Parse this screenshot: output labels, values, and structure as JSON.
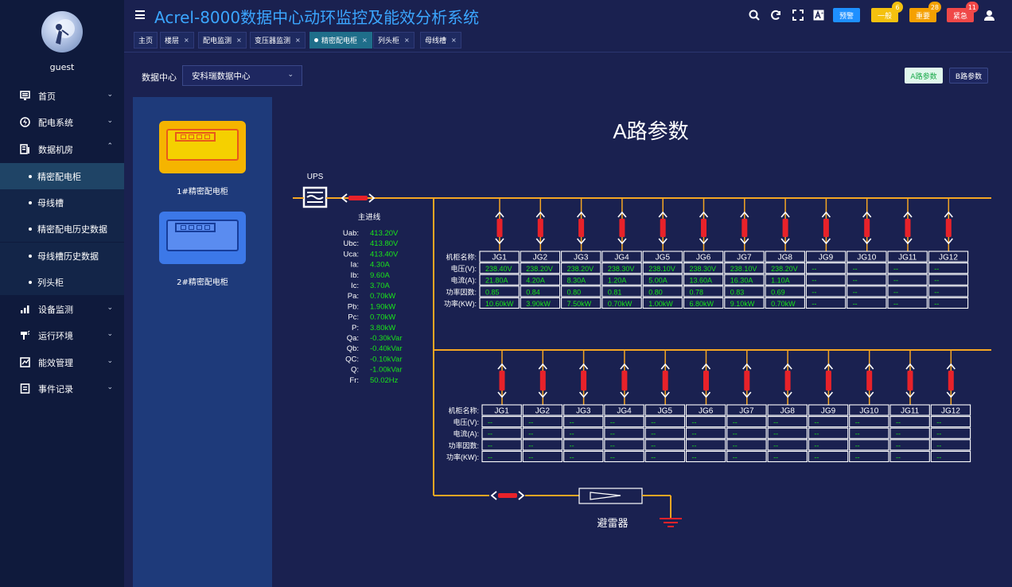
{
  "user": {
    "name": "guest"
  },
  "app": {
    "title": "Acrel-8000数据中心动环监控及能效分析系统"
  },
  "tabs": [
    {
      "label": "主页",
      "closable": false,
      "active": false
    },
    {
      "label": "楼层",
      "closable": true,
      "active": false
    },
    {
      "label": "配电监测",
      "closable": true,
      "active": false
    },
    {
      "label": "变压器监测",
      "closable": true,
      "active": false
    },
    {
      "label": "精密配电柜",
      "closable": true,
      "active": true
    },
    {
      "label": "列头柜",
      "closable": true,
      "active": false
    },
    {
      "label": "母线槽",
      "closable": true,
      "active": false
    }
  ],
  "toolbar": {
    "icons": [
      "search-icon",
      "refresh-icon",
      "fullscreen-icon",
      "font-size-icon"
    ],
    "alerts": [
      {
        "label": "预警",
        "count": "",
        "color": "#1e90ff"
      },
      {
        "label": "一般",
        "count": "6",
        "color": "#f4c10f"
      },
      {
        "label": "重要",
        "count": "28",
        "color": "#f5a000"
      },
      {
        "label": "紧急",
        "count": "11",
        "color": "#f04848"
      }
    ]
  },
  "sidebar": {
    "items": [
      {
        "label": "首页",
        "icon": "monitor-icon",
        "expanded": false
      },
      {
        "label": "配电系统",
        "icon": "power-distribution-icon",
        "expanded": false
      },
      {
        "label": "数据机房",
        "icon": "server-room-icon",
        "expanded": true,
        "children": [
          "精密配电柜",
          "母线槽",
          "精密配电历史数据",
          "母线槽历史数据",
          "列头柜"
        ]
      },
      {
        "label": "设备监测",
        "icon": "chart-icon",
        "expanded": false
      },
      {
        "label": "运行环境",
        "icon": "environment-icon",
        "expanded": false
      },
      {
        "label": "能效管理",
        "icon": "energy-icon",
        "expanded": false
      },
      {
        "label": "事件记录",
        "icon": "event-log-icon",
        "expanded": false
      }
    ],
    "active_child": "精密配电柜"
  },
  "filter": {
    "label": "数据中心",
    "value": "安科瑞数据中心"
  },
  "param_buttons": {
    "a": "A路参数",
    "b": "B路参数"
  },
  "cabinets": [
    {
      "label": "1#精密配电柜",
      "color": "#f5b400"
    },
    {
      "label": "2#精密配电柜",
      "color": "#3c78e8"
    }
  ],
  "diagram": {
    "title": "A路参数",
    "ups_label": "UPS",
    "main_line_label": "主进线",
    "main_params": [
      {
        "name": "Uab:",
        "value": "413.20V"
      },
      {
        "name": "Ubc:",
        "value": "413.80V"
      },
      {
        "name": "Uca:",
        "value": "413.40V"
      },
      {
        "name": "Ia:",
        "value": "4.30A"
      },
      {
        "name": "Ib:",
        "value": "9.60A"
      },
      {
        "name": "Ic:",
        "value": "3.70A"
      },
      {
        "name": "Pa:",
        "value": "0.70kW"
      },
      {
        "name": "Pb:",
        "value": "1.90kW"
      },
      {
        "name": "Pc:",
        "value": "0.70kW"
      },
      {
        "name": "P:",
        "value": "3.80kW"
      },
      {
        "name": "Qa:",
        "value": "-0.30kVar"
      },
      {
        "name": "Qb:",
        "value": "-0.40kVar"
      },
      {
        "name": "QC:",
        "value": "-0.10kVar"
      },
      {
        "name": "Q:",
        "value": "-1.00kVar"
      },
      {
        "name": "Fr:",
        "value": "50.02Hz"
      }
    ],
    "row_labels": [
      "机柜名称:",
      "电压(V):",
      "电流(A):",
      "功率因数:",
      "功率(KW):"
    ],
    "group1": {
      "names": [
        "JG1",
        "JG2",
        "JG3",
        "JG4",
        "JG5",
        "JG6",
        "JG7",
        "JG8",
        "JG9",
        "JG10",
        "JG11",
        "JG12"
      ],
      "voltage": [
        "238.40V",
        "238.20V",
        "238.20V",
        "238.30V",
        "238.10V",
        "238.30V",
        "238.10V",
        "238.20V",
        "--",
        "--",
        "--",
        "--"
      ],
      "current": [
        "21.80A",
        "4.20A",
        "8.30A",
        "1.20A",
        "5.00A",
        "13.60A",
        "16.30A",
        "1.10A",
        "--",
        "--",
        "--",
        "--"
      ],
      "pf": [
        "0.85",
        "0.84",
        "0.80",
        "0.81",
        "0.80",
        "0.78",
        "0.83",
        "0.69",
        "--",
        "--",
        "--",
        "--"
      ],
      "power": [
        "10.60kW",
        "3.90kW",
        "7.50kW",
        "0.70kW",
        "1.00kW",
        "6.80kW",
        "9.10kW",
        "0.70kW",
        "--",
        "--",
        "--",
        "--"
      ]
    },
    "group2": {
      "names": [
        "JG1",
        "JG2",
        "JG3",
        "JG4",
        "JG5",
        "JG6",
        "JG7",
        "JG8",
        "JG9",
        "JG10",
        "JG11",
        "JG12"
      ],
      "voltage": [
        "--",
        "--",
        "--",
        "--",
        "--",
        "--",
        "--",
        "--",
        "--",
        "--",
        "--",
        "--"
      ],
      "current": [
        "--",
        "--",
        "--",
        "--",
        "--",
        "--",
        "--",
        "--",
        "--",
        "--",
        "--",
        "--"
      ],
      "pf": [
        "--",
        "--",
        "--",
        "--",
        "--",
        "--",
        "--",
        "--",
        "--",
        "--",
        "--",
        "--"
      ],
      "power": [
        "--",
        "--",
        "--",
        "--",
        "--",
        "--",
        "--",
        "--",
        "--",
        "--",
        "--",
        "--"
      ]
    },
    "arrester_label": "避雷器",
    "colors": {
      "bus": "#f5a623",
      "value": "#19e619",
      "breaker": "#e8222a"
    }
  }
}
